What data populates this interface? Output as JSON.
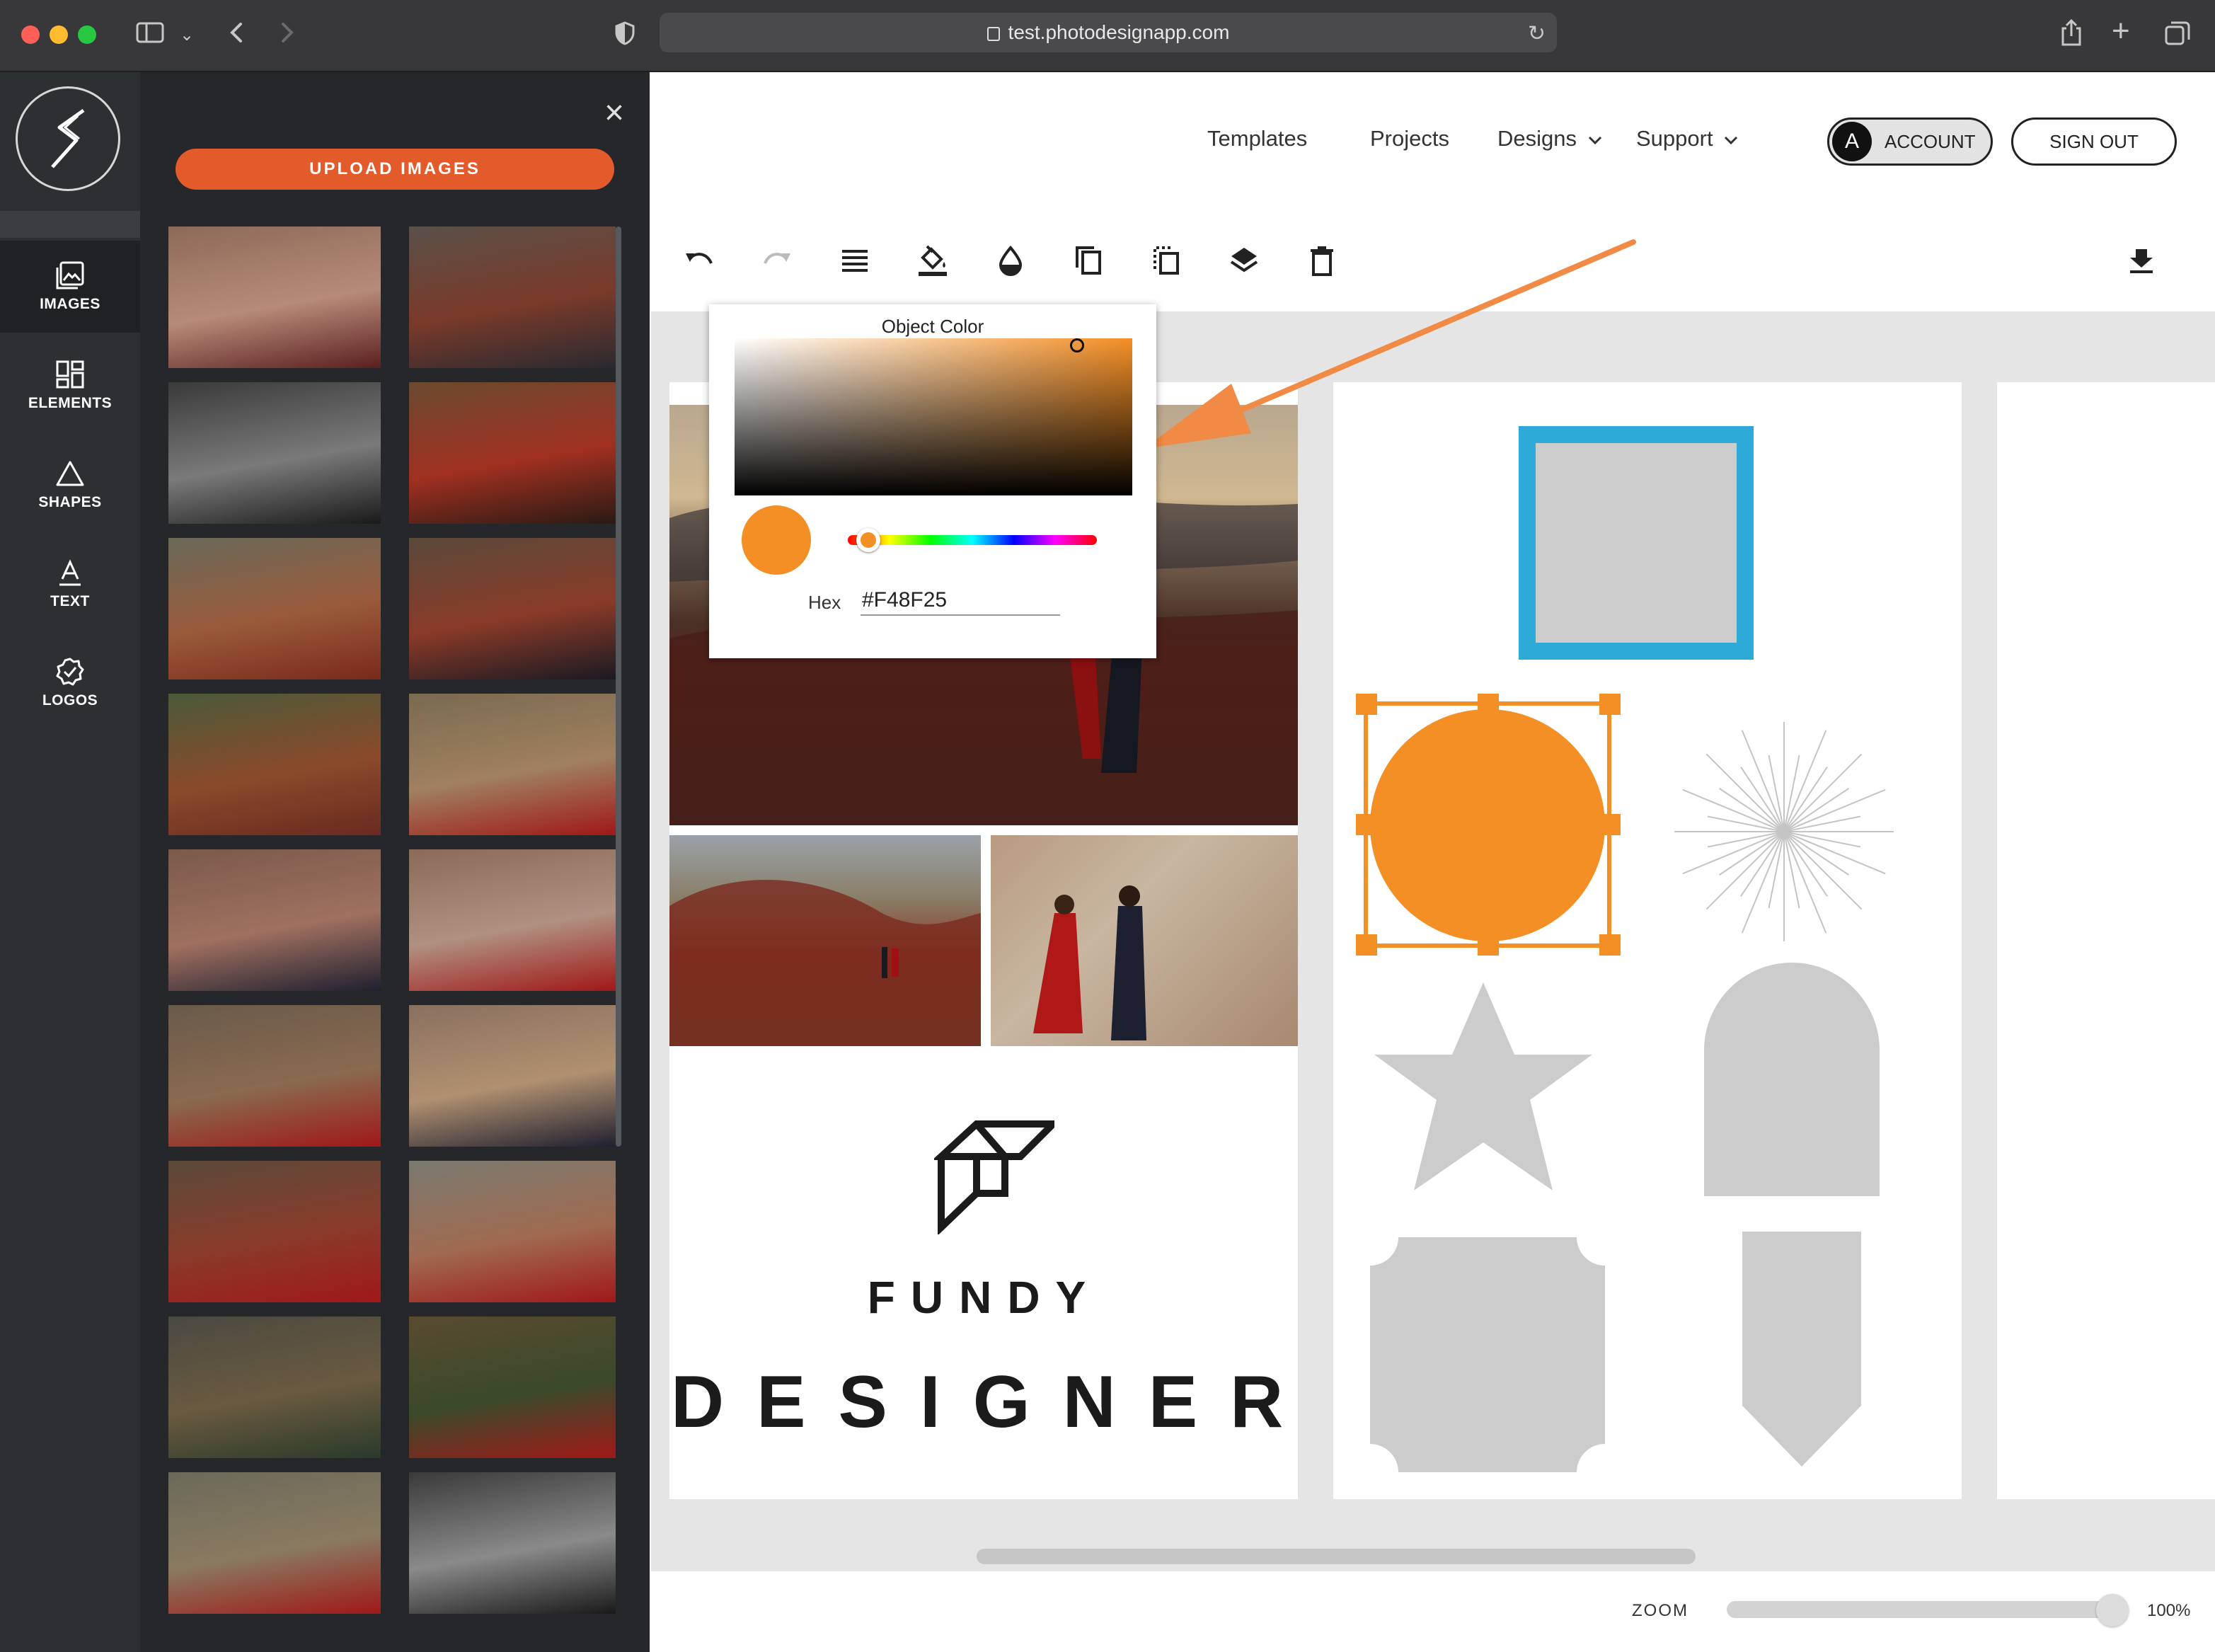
{
  "browser": {
    "url": "test.photodesignapp.com"
  },
  "colors": {
    "accent_orange": "#f48f25",
    "upload_button": "#e35a2b",
    "frame_blue": "#2eaad8",
    "shape_gray": "#cccccc",
    "rail_bg": "#2d3033",
    "panel_bg": "#25272a"
  },
  "rail": {
    "items": [
      {
        "label": "IMAGES",
        "icon": "images-icon",
        "active": true
      },
      {
        "label": "ELEMENTS",
        "icon": "elements-icon",
        "active": false
      },
      {
        "label": "SHAPES",
        "icon": "shapes-icon",
        "active": false
      },
      {
        "label": "TEXT",
        "icon": "text-icon",
        "active": false
      },
      {
        "label": "LOGOS",
        "icon": "logos-icon",
        "active": false
      }
    ]
  },
  "panel": {
    "upload_label": "UPLOAD IMAGES",
    "close_icon": "close-icon"
  },
  "header": {
    "nav": {
      "templates": "Templates",
      "projects": "Projects",
      "designs": "Designs",
      "support": "Support"
    },
    "account_initial": "A",
    "account_label": "ACCOUNT",
    "signout_label": "SIGN OUT"
  },
  "toolbar": {
    "tools": [
      "undo-icon",
      "redo-icon",
      "align-icon",
      "fill-color-icon",
      "opacity-icon",
      "duplicate-icon",
      "crop-icon",
      "layers-icon",
      "delete-icon"
    ],
    "download_icon": "download-icon"
  },
  "color_picker": {
    "title": "Object Color",
    "hex_label": "Hex",
    "hex_value": "#F48F25",
    "hue_position": 0.08
  },
  "design": {
    "brand_top": "FUNDY",
    "brand_bottom": "DESIGNER"
  },
  "zoom": {
    "label": "ZOOM",
    "value": "100%",
    "level": 1.0
  }
}
